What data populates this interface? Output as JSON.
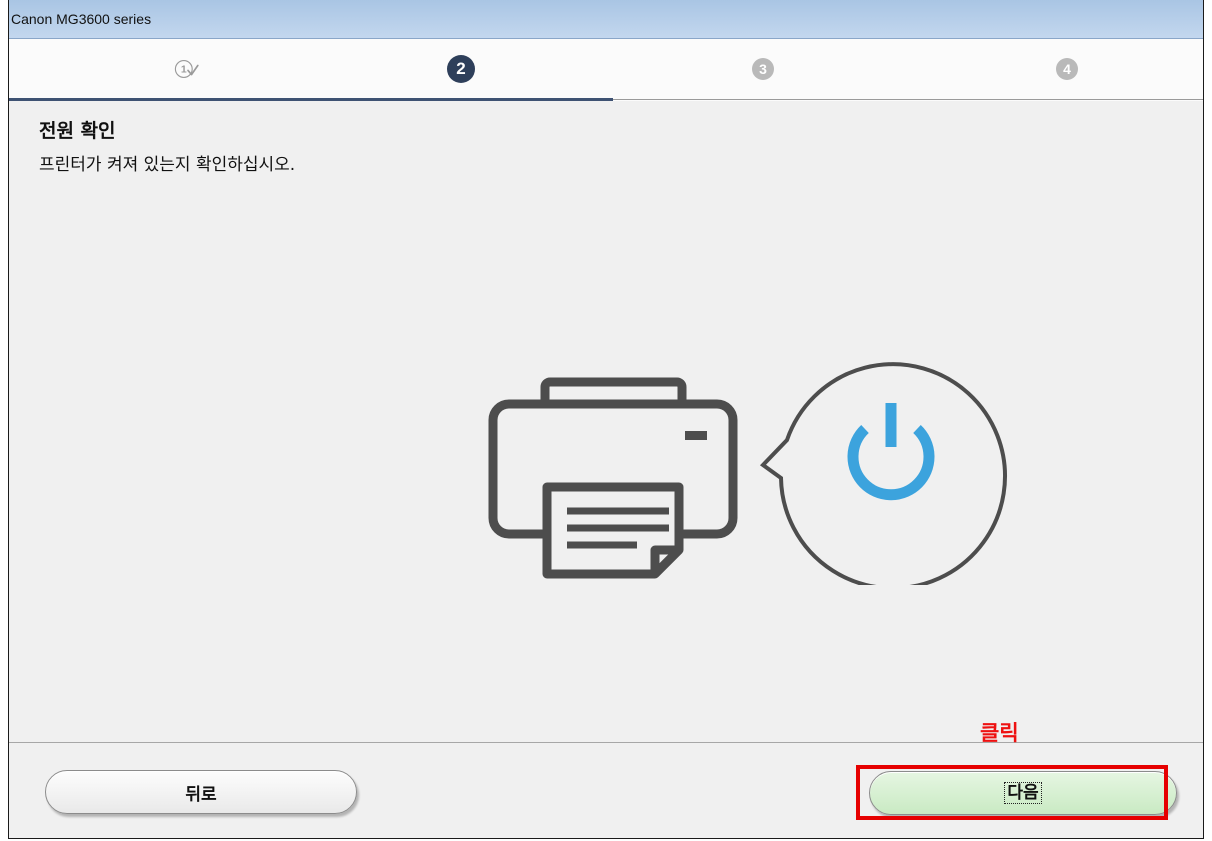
{
  "window": {
    "title": "Canon MG3600 series"
  },
  "steps": [
    {
      "label": "1",
      "state": "done"
    },
    {
      "label": "2",
      "state": "current"
    },
    {
      "label": "3",
      "state": "pending"
    },
    {
      "label": "4",
      "state": "pending"
    }
  ],
  "content": {
    "heading": "전원 확인",
    "description": "프린터가 켜져 있는지 확인하십시오."
  },
  "buttons": {
    "back_label": "뒤로",
    "next_label": "다음"
  },
  "annotation": {
    "text": "클릭",
    "color": "#ee1111"
  },
  "colors": {
    "power_icon": "#3ca3dd",
    "printer_outline": "#4d4d4d",
    "current_step": "#2e3f5a"
  },
  "icons": {
    "printer": "printer-icon",
    "power": "power-icon"
  }
}
